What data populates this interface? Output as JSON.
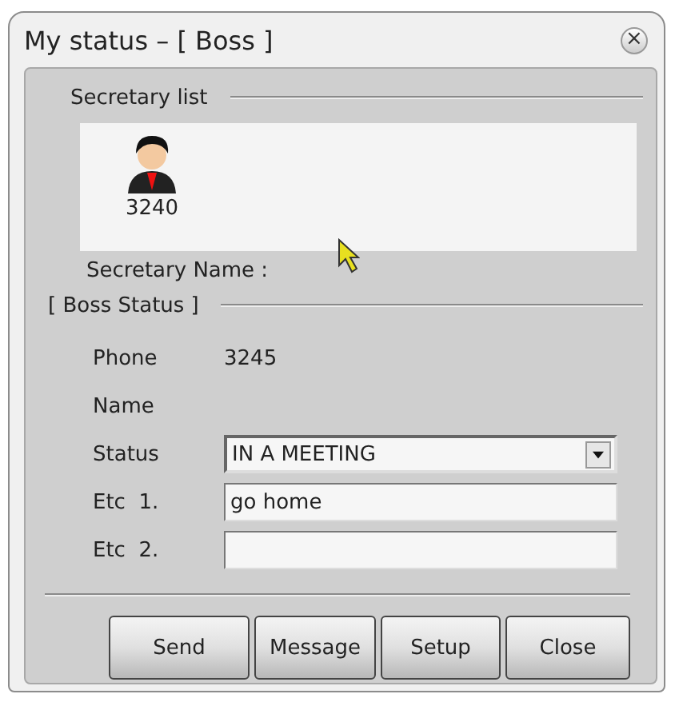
{
  "window": {
    "title": "My status – [ Boss ]",
    "close": "×"
  },
  "secretary_list": {
    "heading": "Secretary list",
    "items": [
      {
        "number": "3240"
      }
    ],
    "name_label": "Secretary Name :"
  },
  "boss_status": {
    "heading": "[ Boss Status ]",
    "rows": [
      {
        "kind": "text",
        "label": "Phone",
        "value": "3245"
      },
      {
        "kind": "text",
        "label": "Name"
      },
      {
        "kind": "select",
        "label": "Status",
        "value": "IN A MEETING"
      },
      {
        "kind": "input",
        "label": "Etc  1.",
        "value": "go home"
      },
      {
        "kind": "input",
        "label": "Etc  2."
      }
    ]
  },
  "buttons": [
    "Send",
    "Message",
    "Setup",
    "Close"
  ]
}
